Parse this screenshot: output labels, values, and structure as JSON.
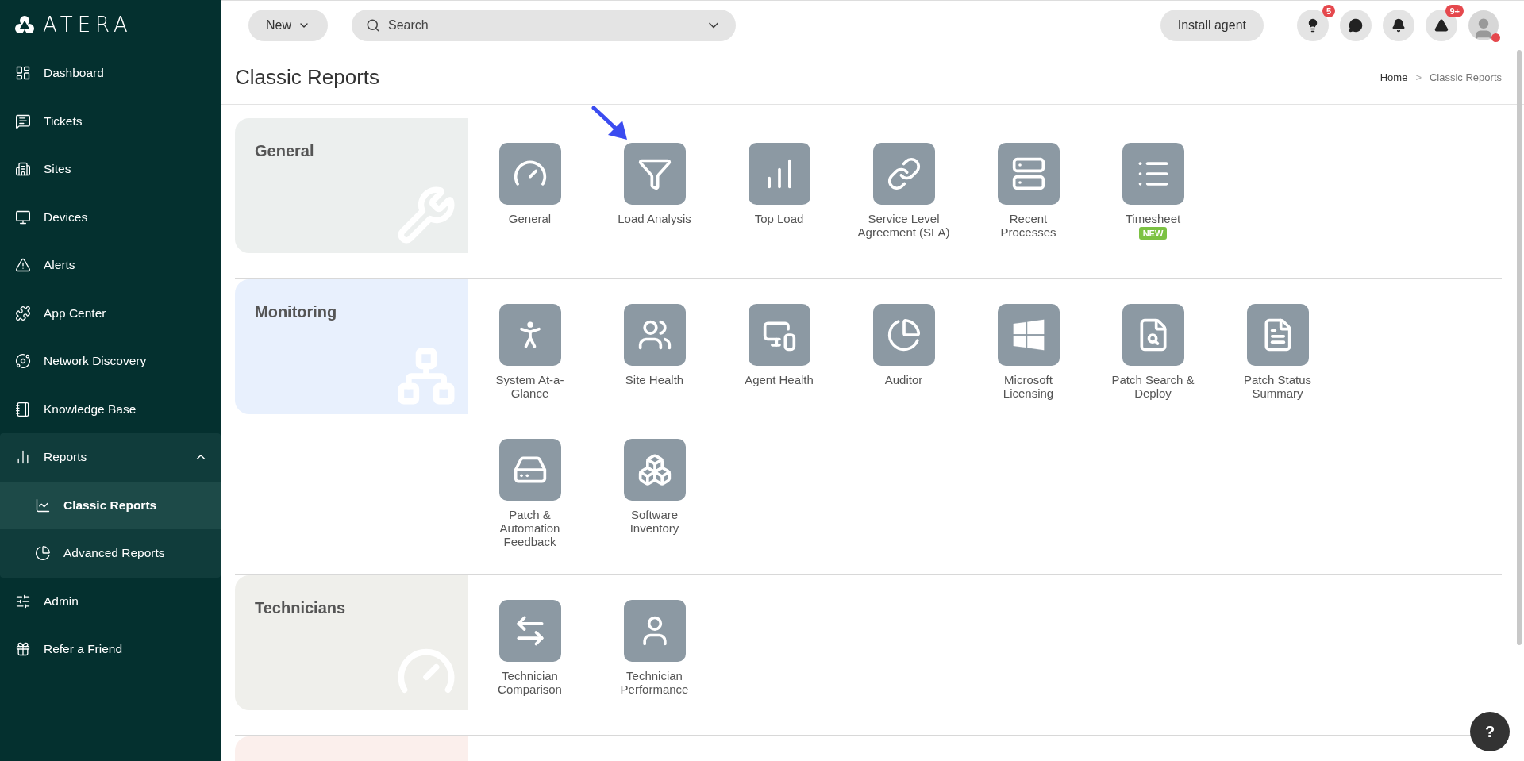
{
  "sidebar": {
    "logo": "ATERA",
    "items": [
      {
        "label": "Dashboard",
        "selected": false
      },
      {
        "label": "Tickets",
        "selected": false
      },
      {
        "label": "Sites",
        "selected": false
      },
      {
        "label": "Devices",
        "selected": false
      },
      {
        "label": "Alerts",
        "selected": false
      },
      {
        "label": "App Center",
        "selected": false
      },
      {
        "label": "Network Discovery",
        "selected": false
      },
      {
        "label": "Knowledge Base",
        "selected": false
      },
      {
        "label": "Reports",
        "selected": false,
        "expanded": true,
        "children": [
          {
            "label": "Classic Reports",
            "selected": true
          },
          {
            "label": "Advanced Reports",
            "selected": false
          }
        ]
      },
      {
        "label": "Admin",
        "selected": false
      },
      {
        "label": "Refer a Friend",
        "selected": false
      }
    ]
  },
  "topbar": {
    "new_button": "New",
    "search": {
      "placeholder": "Search"
    },
    "install_button": "Install agent",
    "tips_badge": "5",
    "alerts_badge": "9+"
  },
  "page": {
    "title": "Classic Reports",
    "breadcrumb": [
      "Home",
      "Classic Reports"
    ],
    "breadcrumb_separator": ">"
  },
  "sections": [
    {
      "title": "General",
      "color": "#ecefee",
      "tiles": [
        {
          "label": "General",
          "marked": false
        },
        {
          "label": "Load Analysis",
          "marked": true
        },
        {
          "label": "Top Load",
          "marked": false
        },
        {
          "label": "Service Level Agreement (SLA)",
          "marked": false
        },
        {
          "label": "Recent Processes",
          "marked": false
        },
        {
          "label": "Timesheet",
          "badge": "NEW",
          "marked": false
        }
      ]
    },
    {
      "title": "Monitoring",
      "color": "#e8f0fd",
      "tiles": [
        {
          "label": "System At-a-Glance",
          "marked": false
        },
        {
          "label": "Site Health",
          "marked": false
        },
        {
          "label": "Agent Health",
          "marked": false
        },
        {
          "label": "Auditor",
          "marked": false
        },
        {
          "label": "Microsoft Licensing",
          "marked": false
        },
        {
          "label": "Patch Search & Deploy",
          "marked": false
        },
        {
          "label": "Patch Status Summary",
          "marked": false
        },
        {
          "label": "Patch & Automation Feedback",
          "marked": false
        },
        {
          "label": "Software Inventory",
          "marked": false
        }
      ]
    },
    {
      "title": "Technicians",
      "color": "#efefeb",
      "tiles": [
        {
          "label": "Technician Comparison",
          "marked": false
        },
        {
          "label": "Technician Performance",
          "marked": false
        }
      ]
    },
    {
      "color": "#fbefec"
    }
  ],
  "help_button": "?"
}
